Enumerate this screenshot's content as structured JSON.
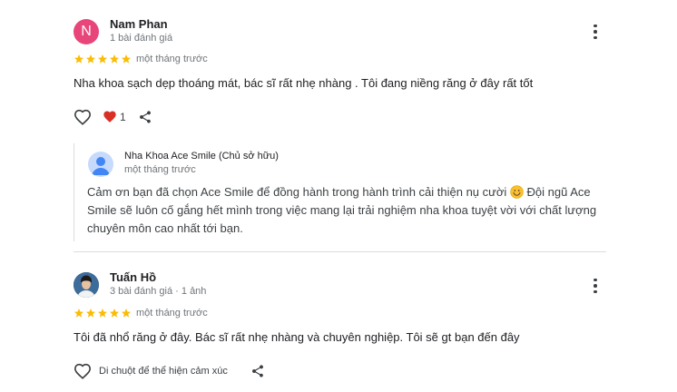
{
  "reviews": [
    {
      "avatar_letter": "N",
      "name": "Nam Phan",
      "meta": "1 bài đánh giá",
      "rating": 5,
      "time": "một tháng trước",
      "text": "Nha khoa sạch dẹp thoáng mát, bác sĩ rất nhẹ nhàng . Tôi đang niềng răng ở đây rất tốt",
      "like_count": "1",
      "reply": {
        "owner_name": "Nha Khoa Ace Smile (Chủ sở hữu)",
        "time": "một tháng trước",
        "text_before_emoji": "Cảm ơn bạn đã chọn Ace Smile để đồng hành trong hành trình cải thiện nụ cười ",
        "emoji": "smiling-face-emoji",
        "text_after_emoji": " Đội ngũ Ace Smile sẽ luôn cố gắng hết mình trong việc mang lại trải nghiệm nha khoa tuyệt vời với chất lượng chuyên môn cao nhất tới bạn."
      }
    },
    {
      "name": "Tuấn Hồ",
      "meta": "3 bài đánh giá · 1 ảnh",
      "rating": 5,
      "time": "một tháng trước",
      "text": "Tôi đã nhổ răng ở đây. Bác sĩ rất nhẹ nhàng và chuyên nghiệp. Tôi sẽ gt bạn đến đây",
      "react_hint": "Di chuột để thể hiện cảm xúc"
    }
  ],
  "colors": {
    "star": "#fbbc04",
    "heart_filled": "#d93025",
    "avatar_letter_bg": "#e8457a",
    "divider": "#dadce0"
  },
  "icons": [
    "more-vert-icon",
    "star-icon",
    "heart-outline-icon",
    "heart-filled-icon",
    "share-icon",
    "owner-avatar-icon"
  ]
}
